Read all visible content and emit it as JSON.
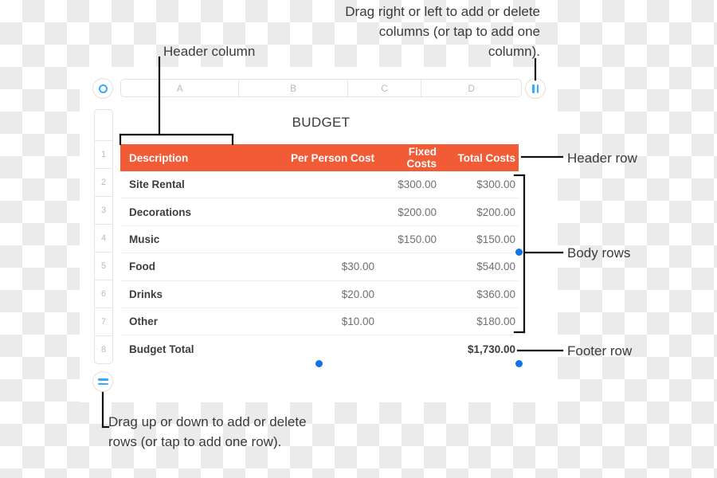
{
  "app": {
    "table_title": "BUDGET"
  },
  "column_headers": [
    "A",
    "B",
    "C",
    "D"
  ],
  "row_numbers": [
    "1",
    "2",
    "3",
    "4",
    "5",
    "6",
    "7",
    "8"
  ],
  "table": {
    "header_row": {
      "description": "Description",
      "per_person_cost": "Per Person Cost",
      "fixed_costs": "Fixed Costs",
      "total_costs": "Total Costs"
    },
    "body_rows": [
      {
        "description": "Site Rental",
        "per_person_cost": "",
        "fixed_costs": "$300.00",
        "total_costs": "$300.00"
      },
      {
        "description": "Decorations",
        "per_person_cost": "",
        "fixed_costs": "$200.00",
        "total_costs": "$200.00"
      },
      {
        "description": "Music",
        "per_person_cost": "",
        "fixed_costs": "$150.00",
        "total_costs": "$150.00"
      },
      {
        "description": "Food",
        "per_person_cost": "$30.00",
        "fixed_costs": "",
        "total_costs": "$540.00"
      },
      {
        "description": "Drinks",
        "per_person_cost": "$20.00",
        "fixed_costs": "",
        "total_costs": "$360.00"
      },
      {
        "description": "Other",
        "per_person_cost": "$10.00",
        "fixed_costs": "",
        "total_costs": "$180.00"
      }
    ],
    "footer_row": {
      "description": "Budget Total",
      "per_person_cost": "",
      "fixed_costs": "",
      "total_costs": "$1,730.00"
    }
  },
  "annotations": {
    "columns_hint": "Drag right or left to add or delete columns (or tap to add one column).",
    "header_column": "Header column",
    "rows_hint": "Drag up or down to add or delete rows (or tap to add one row).",
    "header_row": "Header row",
    "body_rows": "Body rows",
    "footer_row": "Footer row"
  },
  "colors": {
    "header_row_fill": "#f15b36",
    "handle_accent": "#33aaff",
    "selection_dot": "#1272e8",
    "annotation_text": "#3a3a3a"
  }
}
